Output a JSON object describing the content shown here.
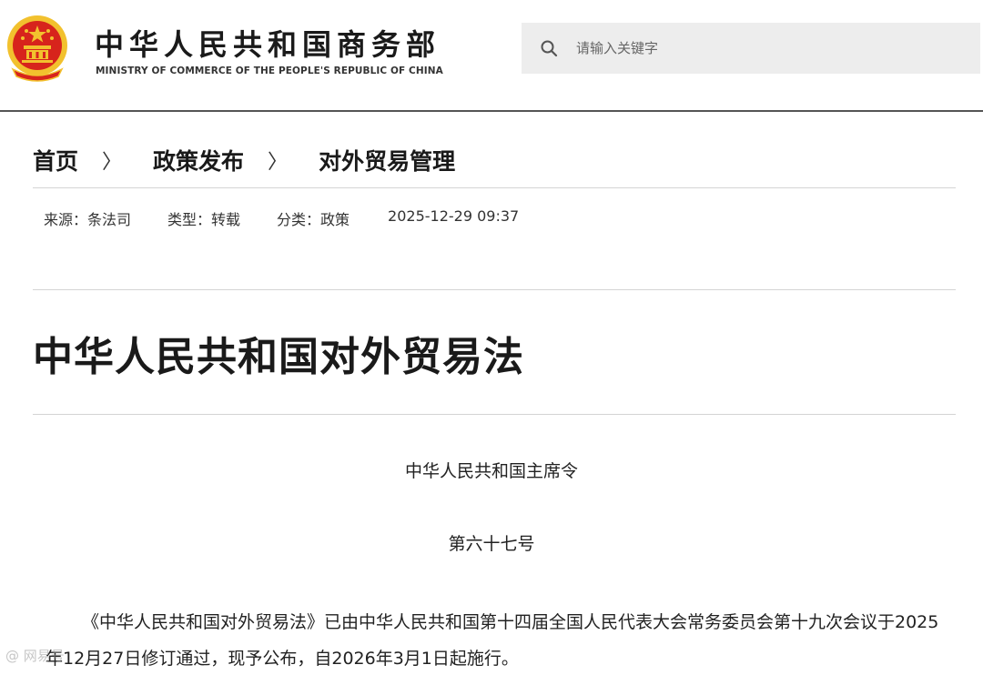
{
  "header": {
    "brand_cn": "中华人民共和国商务部",
    "brand_en": "MINISTRY OF COMMERCE OF THE PEOPLE'S REPUBLIC OF CHINA",
    "emblem_icon": "national-emblem-icon",
    "search": {
      "placeholder": "请输入关键字",
      "icon": "search-icon"
    }
  },
  "breadcrumb": {
    "items": [
      "首页",
      "政策发布",
      "对外贸易管理"
    ],
    "separator": "〉"
  },
  "meta": {
    "source": "来源：条法司",
    "type": "类型：转载",
    "category": "分类：政策",
    "date": "2025-12-29 09:37"
  },
  "article": {
    "title": "中华人民共和国对外贸易法",
    "order_title": "中华人民共和国主席令",
    "order_number": "第六十七号",
    "paragraph": "《中华人民共和国对外贸易法》已由中华人民共和国第十四届全国人民代表大会常务委员会第十九次会议于2025年12月27日修订通过，现予公布，自2026年3月1日起施行。"
  },
  "watermark": "@ 网易号",
  "colors": {
    "emblem_red": "#d7241c",
    "emblem_gold": "#f2c12e",
    "search_bg": "#ededed"
  }
}
